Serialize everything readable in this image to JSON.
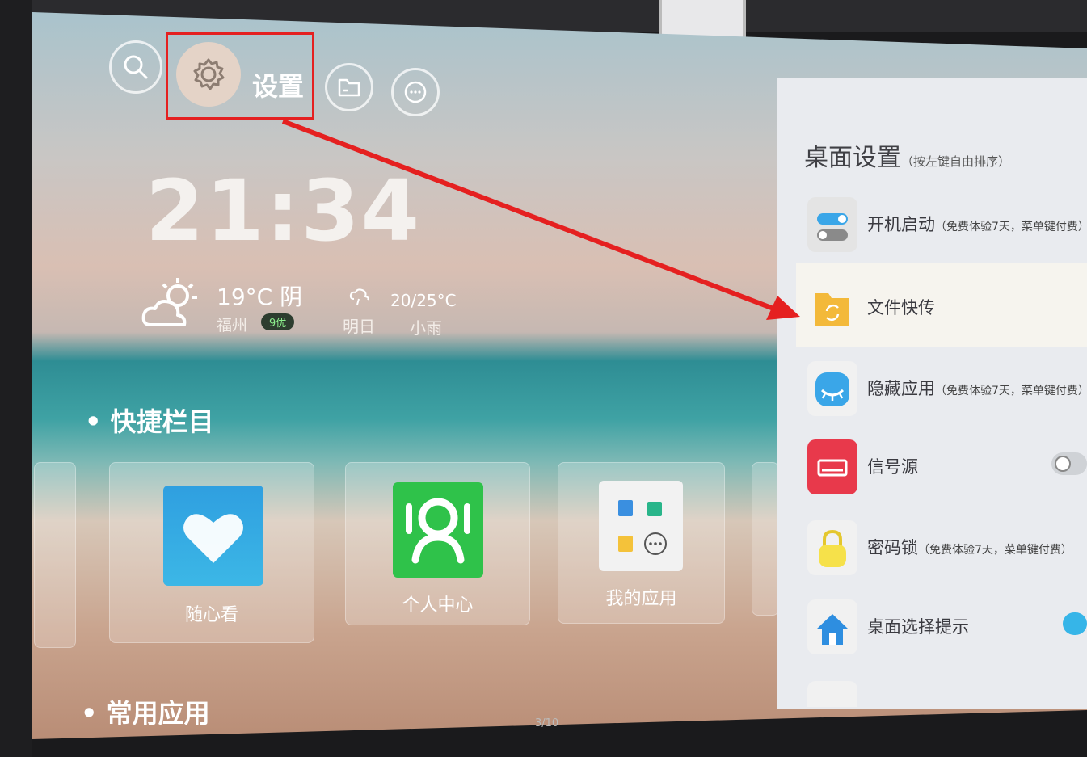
{
  "header": {
    "settings_label": "设置",
    "icons": [
      "search-icon",
      "gear-icon",
      "folder-icon",
      "message-icon"
    ]
  },
  "clock": {
    "time": "21:34"
  },
  "weather": {
    "today_temp": "19°C 阴",
    "city": "福州",
    "aqi": "9优",
    "tomorrow_temp": "20/25°C",
    "tomorrow_label": "明日",
    "tomorrow_condition": "小雨"
  },
  "quick_section": {
    "title": "快捷栏目",
    "apps": [
      {
        "label": "随心看",
        "icon": "heart-icon",
        "color": "#2f9fe0"
      },
      {
        "label": "个人中心",
        "icon": "person-icon",
        "color": "#2fc24a"
      },
      {
        "label": "我的应用",
        "icon": "apps-grid-icon",
        "color": "#f2f2f2"
      }
    ]
  },
  "common_section": {
    "title": "常用应用"
  },
  "page_indicator": "3/10",
  "settings_panel": {
    "title": "桌面设置",
    "title_note": "（按左键自由排序）",
    "items": [
      {
        "label": "开机启动",
        "note": "（免费体验7天，菜单键付费）",
        "icon": "toggle-switch-icon",
        "color": "#e4e4e4"
      },
      {
        "label": "文件快传",
        "note": "",
        "icon": "folder-sync-icon",
        "color": "#f3b93a"
      },
      {
        "label": "隐藏应用",
        "note": "（免费体验7天，菜单键付费）",
        "icon": "closed-eye-icon",
        "color": "#3aa6e8"
      },
      {
        "label": "信号源",
        "note": "",
        "icon": "input-source-icon",
        "color": "#e8394b",
        "toggle": "off"
      },
      {
        "label": "密码锁",
        "note": "（免费体验7天，菜单键付费）",
        "icon": "padlock-icon",
        "color": "#f6e14a"
      },
      {
        "label": "桌面选择提示",
        "note": "",
        "icon": "home-icon",
        "color": "#2e8ee0",
        "toggle": "on"
      }
    ]
  },
  "colors": {
    "highlight": "#e52020",
    "toggle_on": "#36b5e8",
    "toggle_off": "#cfd2d6"
  }
}
